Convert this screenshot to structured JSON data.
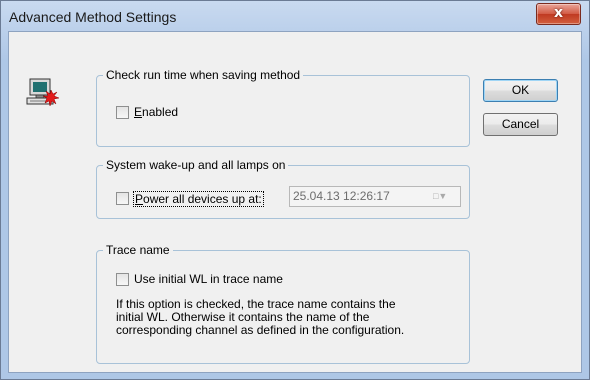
{
  "window": {
    "title": "Advanced Method Settings",
    "close_glyph": "x"
  },
  "icon": {
    "name": "computer-alert-icon"
  },
  "groups": {
    "run_time": {
      "legend": "Check run time when saving method",
      "checkbox_label_prefix": "",
      "checkbox_label_underlined": "E",
      "checkbox_label_rest": "nabled",
      "checked": false
    },
    "wake_up": {
      "legend": "System wake-up and all lamps on",
      "checkbox_label_underlined": "P",
      "checkbox_label_rest": "ower all devices up at:",
      "checked": false,
      "datetime_value": "25.04.13 12:26:17",
      "enabled": false
    },
    "trace_name": {
      "legend": "Trace name",
      "checkbox_label": "Use initial WL in trace name",
      "checked": false,
      "description_lines": [
        "If this option is checked, the trace name contains the",
        "initial WL. Otherwise it contains the name of the",
        "corresponding channel as defined in the configuration."
      ]
    }
  },
  "buttons": {
    "ok": "OK",
    "cancel": "Cancel"
  },
  "colors": {
    "title_gradient_top": "#c9daf0",
    "client_bg": "#f0f0f0",
    "group_border": "#a8c2d8",
    "close_red": "#c03a22"
  }
}
